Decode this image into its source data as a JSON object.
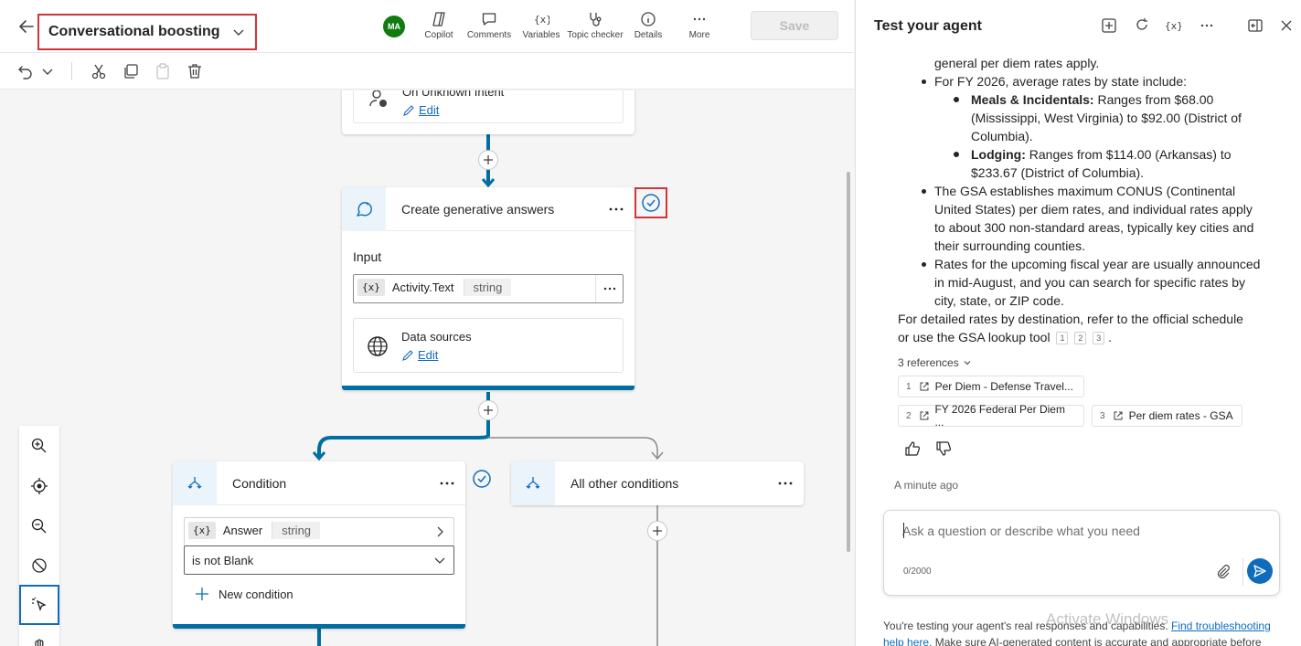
{
  "designer": {
    "topic_title": "Conversational boosting",
    "user_initials": "MA",
    "toolbar": [
      {
        "label": "Copilot",
        "icon": "copilot-icon"
      },
      {
        "label": "Comments",
        "icon": "comment-icon"
      },
      {
        "label": "Variables",
        "icon": "variables-icon"
      },
      {
        "label": "Topic checker",
        "icon": "stethoscope-icon"
      },
      {
        "label": "Details",
        "icon": "info-icon"
      },
      {
        "label": "More",
        "icon": "more-icon"
      }
    ],
    "save_label": "Save",
    "trigger_node": {
      "partial_title": "On Unknown Intent",
      "edit_label": "Edit"
    },
    "generative_node": {
      "title": "Create generative answers",
      "input_label": "Input",
      "input_var": {
        "badge": "{x}",
        "name": "Activity.Text",
        "type": "string"
      },
      "data_sources_label": "Data sources",
      "edit_label": "Edit"
    },
    "condition_node": {
      "title": "Condition",
      "var": {
        "badge": "{x}",
        "name": "Answer",
        "type": "string"
      },
      "operator": "is not Blank",
      "new_condition_label": "New condition"
    },
    "other_conditions_node": {
      "title": "All other conditions"
    }
  },
  "test_pane": {
    "title": "Test your agent",
    "lines": {
      "l0": "general per diem rates apply.",
      "b1": "For FY 2026, average rates by state include:",
      "s1_bold": "Meals & Incidentals:",
      "s1_a": " Ranges from $68.00",
      "s1_b": "(Mississippi, West Virginia) to $92.00 (District of",
      "s1_c": "Columbia).",
      "s2_bold": "Lodging:",
      "s2_a": " Ranges from $114.00 (Arkansas) to",
      "s2_b": "$233.67 (District of Columbia).",
      "b2_a": "The GSA establishes maximum CONUS (Continental",
      "b2_b": "United States) per diem rates, and individual rates apply",
      "b2_c": "to about 300 non-standard areas, typically key cities and",
      "b2_d": "their surrounding counties.",
      "b3_a": "Rates for the upcoming fiscal year are usually announced",
      "b3_b": "in mid-August, and you can search for specific rates by",
      "b3_c": "city, state, or ZIP code.",
      "p_a": "For detailed rates by destination, refer to the official schedule",
      "p_b": "or use the GSA lookup tool",
      "cite1": "1",
      "cite2": "2",
      "cite3": "3",
      "p_end": "."
    },
    "references_label": "3 references",
    "references": [
      {
        "num": "1",
        "label": "Per Diem - Defense Travel..."
      },
      {
        "num": "2",
        "label": "FY 2026 Federal Per Diem ..."
      },
      {
        "num": "3",
        "label": "Per diem rates - GSA"
      }
    ],
    "timestamp": "A minute ago",
    "input_placeholder": "Ask a question or describe what you need",
    "char_count": "0/2000",
    "footer_text": "You're testing your agent's real responses and capabilities.",
    "footer_link": "Find troubleshooting",
    "footer_text2": "help here.",
    "footer_text3": "Make sure AI-generated content is accurate and appropriate before",
    "watermark": "Activate Windows"
  }
}
